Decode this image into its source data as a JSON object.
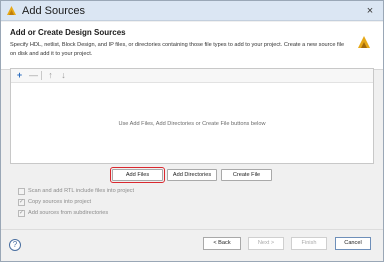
{
  "window": {
    "title": "Add Sources",
    "close_label": "×"
  },
  "header": {
    "title": "Add or Create Design Sources",
    "description": "Specify HDL, netlist, Block Design, and IP files, or directories containing those file types to add to your project. Create a new source file on disk and add it to your project."
  },
  "toolbar": {
    "add_label": "+",
    "remove_label": "—",
    "up_label": "↑",
    "down_label": "↓"
  },
  "panel": {
    "empty_message": "Use Add Files, Add Directories or Create File buttons below"
  },
  "actions": {
    "add_files": "Add Files",
    "add_directories": "Add Directories",
    "create_file": "Create File"
  },
  "options": {
    "scan_rtl": "Scan and add RTL include files into project",
    "copy_sources": "Copy sources into project",
    "add_subdirs": "Add sources from subdirectories"
  },
  "footer": {
    "help": "?",
    "back": "< Back",
    "next": "Next >",
    "finish": "Finish",
    "cancel": "Cancel"
  },
  "colors": {
    "focus_border": "#d9282f",
    "titlebar_bg": "#dbe6f3",
    "accent_blue": "#2f6fbf"
  }
}
